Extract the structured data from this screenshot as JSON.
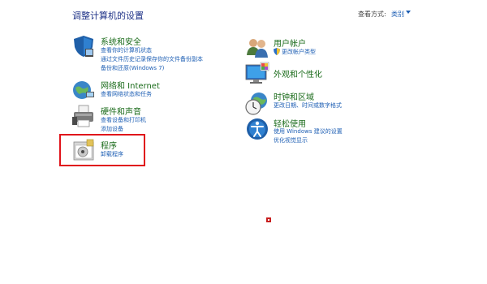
{
  "page": {
    "title": "调整计算机的设置",
    "view_by_label": "查看方式:",
    "view_by_value": "类别"
  },
  "left_categories": [
    {
      "name": "系统和安全",
      "icon": "shield-icon",
      "links": [
        "查看你的计算机状态",
        "通过文件历史记录保存你的文件备份副本",
        "备份和还原(Windows 7)"
      ]
    },
    {
      "name": "网络和 Internet",
      "icon": "globe-network-icon",
      "links": [
        "查看网络状态和任务"
      ]
    },
    {
      "name": "硬件和声音",
      "icon": "printer-icon",
      "links": [
        "查看设备和打印机",
        "添加设备"
      ]
    },
    {
      "name": "程序",
      "icon": "programs-icon",
      "links": [
        "卸载程序"
      ]
    }
  ],
  "right_categories": [
    {
      "name": "用户帐户",
      "icon": "users-icon",
      "links": [
        "更改帐户类型"
      ]
    },
    {
      "name": "外观和个性化",
      "icon": "monitor-palette-icon",
      "links": []
    },
    {
      "name": "时钟和区域",
      "icon": "clock-globe-icon",
      "links": [
        "更改日期、时间或数字格式"
      ]
    },
    {
      "name": "轻松使用",
      "icon": "ease-of-access-icon",
      "links": [
        "使用 Windows 建议的设置",
        "优化视觉显示"
      ]
    }
  ],
  "colors": {
    "heading_green": "#1a6b1a",
    "link_blue": "#1e5fb4",
    "title_blue": "#1e3287",
    "highlight_red": "#e0141b"
  }
}
